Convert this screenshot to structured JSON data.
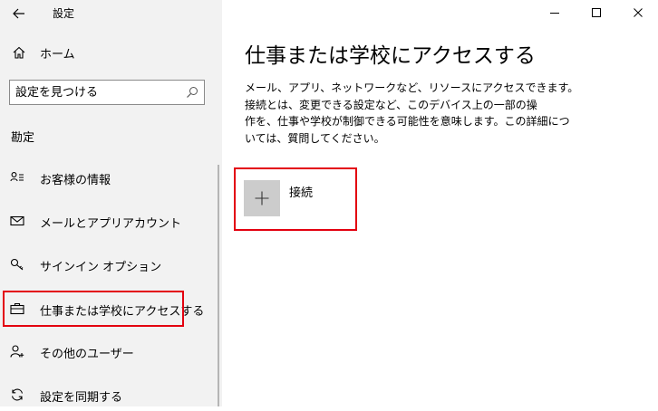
{
  "window": {
    "title": "設定",
    "controls": [
      "minimize",
      "maximize",
      "close"
    ]
  },
  "sidebar": {
    "home_label": "ホーム",
    "search_placeholder": "設定を見つける",
    "section_title": "勘定",
    "items": [
      {
        "label": "お客様の情報",
        "icon": "person-card-icon"
      },
      {
        "label": "メールとアプリアカウント",
        "icon": "mail-icon"
      },
      {
        "label": "サインイン オプション",
        "icon": "key-icon"
      },
      {
        "label": "仕事または学校にアクセスする",
        "icon": "briefcase-icon",
        "selected": true
      },
      {
        "label": "その他のユーザー",
        "icon": "person-add-icon"
      },
      {
        "label": "設定を同期する",
        "icon": "sync-icon"
      }
    ]
  },
  "main": {
    "title": "仕事または学校にアクセスする",
    "description_lines": [
      "メール、アプリ、ネットワークなど、リソースにアクセスできます。",
      "接続とは、変更できる設定など、このデバイス上の一部の操",
      "作を、仕事や学校が制御できる可能性を意味します。この詳細につ",
      "いては、質問してください。"
    ],
    "connect_label": "接続"
  },
  "colors": {
    "sidebar_bg": "#f2f2f2",
    "highlight": "#e3000f",
    "plus_tile": "#cccccc"
  }
}
